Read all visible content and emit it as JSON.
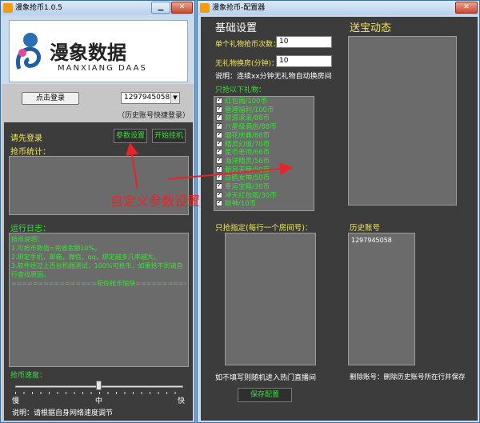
{
  "left": {
    "title": "漫象抢币1.0.5",
    "logo_text": "漫象数据",
    "logo_sub": "MANXIANG DAAS",
    "login_btn": "点击登录",
    "account": "1297945058",
    "account_hint": "（历史账号快捷登录）",
    "status": "请先登录",
    "params_btn": "参数设置",
    "start_btn": "开始挂机",
    "stats_label": "抢币统计：",
    "log_label": "运行日志：",
    "log_lines": [
      "抢币说明：",
      "1.可抢币数值=充值金额10%。",
      "2.绑定手机，邮箱，微信，qq，绑定越多几率越大。",
      "3.软件经过上百台机器测试，100%可抢币，如果抢不到请自行查找原因。",
      "================祝你抢币愉快================"
    ],
    "speed_label": "抢币速度：",
    "speed_slow": "慢",
    "speed_mid": "中",
    "speed_fast": "快",
    "speed_level": 0.5,
    "speed_note": "说明：请根据自身网络速度调节"
  },
  "annotation": "自定义参数设置",
  "right": {
    "title": "漫象抢币-配置器",
    "basic_title": "基础设置",
    "gift_count_label": "单个礼物抢币次数：",
    "gift_count_value": "10",
    "no_gift_label": "无礼物换房(分钟)：",
    "no_gift_value": "10",
    "no_gift_note": "说明：连续xx分钟无礼物自动换房间",
    "gift_list_label": "只抢以下礼物：",
    "gifts": [
      "红包雨/100币",
      "管理福利/100币",
      "财源滚滚/88币",
      "八星级酒店/88币",
      "烟花庆典/88币",
      "精灵幻境/70币",
      "星币老师/66币",
      "海洋精灵/56币",
      "新月天使/50币",
      "白鹤女神/50币",
      "幸运宝箱/30币",
      "冲天红包雨/30币",
      "财神/10币"
    ],
    "dynamics_title": "送宝动态",
    "room_label": "只抢指定(每行一个房间号)：",
    "room_note": "如不填写则随机进入热门直播间",
    "history_label": "历史账号",
    "history_account": "1297945058",
    "history_note": "删除账号：删除历史账号所在行并保存",
    "save_btn": "保存配置"
  },
  "colors": {
    "accent_green": "#38e038",
    "annotation_red": "#e8242a",
    "panel_bg": "#3c3c3c"
  }
}
